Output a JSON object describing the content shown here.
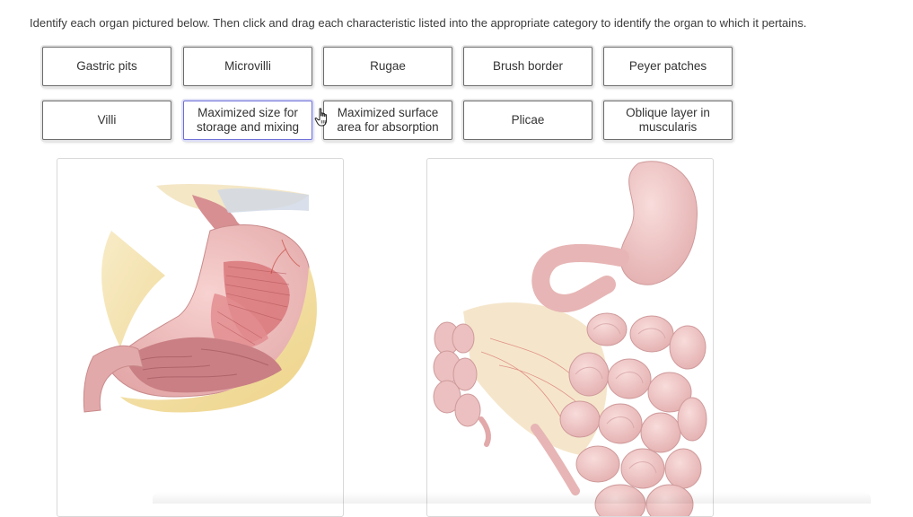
{
  "instructions": "Identify each organ pictured below.  Then click and drag each characteristic listed into the appropriate category to identify the organ to which it pertains.",
  "chips": {
    "gastric_pits": "Gastric pits",
    "microvilli": "Microvilli",
    "rugae": "Rugae",
    "brush_border": "Brush border",
    "peyer_patches": "Peyer patches",
    "villi": "Villi",
    "maximized_size_line1": "Maximized size for",
    "maximized_size_line2": "storage and mixing",
    "maximized_surface_line1": "Maximized surface",
    "maximized_surface_line2": "area for absorption",
    "plicae": "Plicae",
    "oblique_line1": "Oblique layer in",
    "oblique_line2": "muscularis"
  },
  "images": {
    "left": "stomach illustration",
    "right": "small intestine illustration"
  },
  "cursor": "hand-pointer-icon",
  "colors": {
    "chip_border": "#6b6b6b",
    "selected_border": "#6d6fd6",
    "organ_pink": "#e8b4b4",
    "muscle_red": "#d9777a",
    "fat_yellow": "#f1dc9e"
  }
}
